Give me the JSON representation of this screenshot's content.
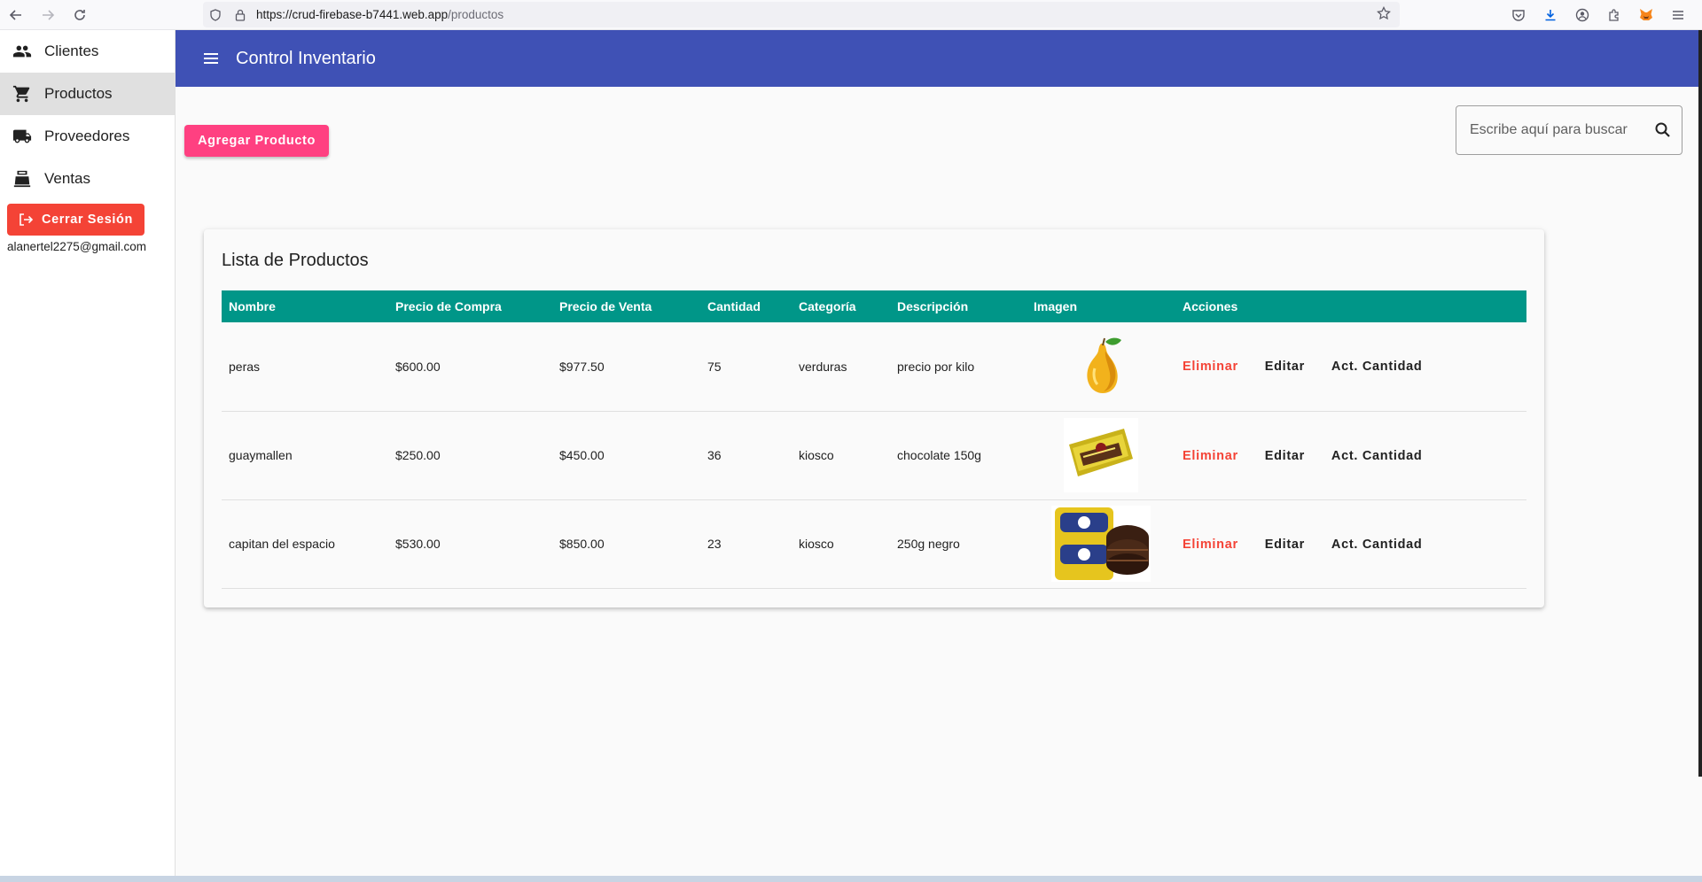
{
  "browser": {
    "url_host": "https://crud-firebase-b7441.web.app",
    "url_path": "/productos"
  },
  "sidebar": {
    "items": [
      {
        "label": "Clientes",
        "icon": "people-icon"
      },
      {
        "label": "Productos",
        "icon": "cart-icon",
        "active": true
      },
      {
        "label": "Proveedores",
        "icon": "truck-icon"
      },
      {
        "label": "Ventas",
        "icon": "register-icon"
      }
    ],
    "logout_label": "Cerrar Sesión",
    "user_email": "alanertel2275@gmail.com"
  },
  "app_bar": {
    "title": "Control Inventario"
  },
  "toolbar": {
    "add_label": "Agregar Producto",
    "search_placeholder": "Escribe aquí para buscar"
  },
  "products": {
    "title": "Lista de Productos",
    "columns": [
      "Nombre",
      "Precio de Compra",
      "Precio de Venta",
      "Cantidad",
      "Categoría",
      "Descripción",
      "Imagen",
      "Acciones"
    ],
    "rows": [
      {
        "nombre": "peras",
        "compra": "$600.00",
        "venta": "$977.50",
        "cantidad": "75",
        "categoria": "verduras",
        "descripcion": "precio por kilo"
      },
      {
        "nombre": "guaymallen",
        "compra": "$250.00",
        "venta": "$450.00",
        "cantidad": "36",
        "categoria": "kiosco",
        "descripcion": "chocolate 150g"
      },
      {
        "nombre": "capitan del espacio",
        "compra": "$530.00",
        "venta": "$850.00",
        "cantidad": "23",
        "categoria": "kiosco",
        "descripcion": "250g negro"
      }
    ],
    "actions": {
      "delete": "Eliminar",
      "edit": "Editar",
      "quantity": "Act. Cantidad"
    }
  },
  "colors": {
    "app_bar": "#3f51b5",
    "table_header": "#009688",
    "add_button": "#ff4081",
    "danger": "#f44336"
  }
}
